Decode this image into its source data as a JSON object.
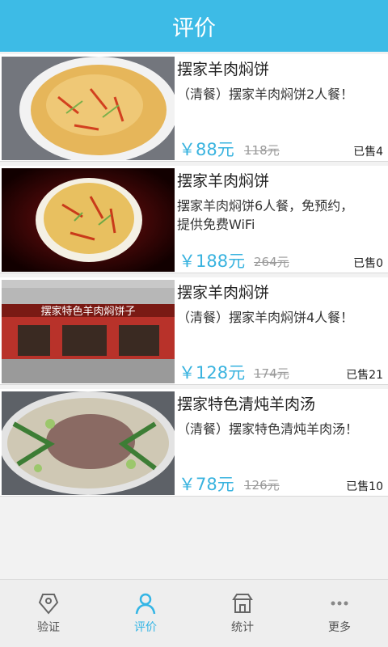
{
  "header": {
    "title": "评价"
  },
  "items": [
    {
      "title": "摆家羊肉焖饼",
      "desc": "（清餐）摆家羊肉焖饼2人餐！",
      "price": "￥88元",
      "orig_price": "118元",
      "sold": "已售4"
    },
    {
      "title": "摆家羊肉焖饼",
      "desc": "摆家羊肉焖饼6人餐，免预约，提供免费WiFi",
      "price": "￥188元",
      "orig_price": "264元",
      "sold": "已售0"
    },
    {
      "title": "摆家羊肉焖饼",
      "desc": "（清餐）摆家羊肉焖饼4人餐！",
      "price": "￥128元",
      "orig_price": "174元",
      "sold": "已售21",
      "sign_text": "摆家特色羊肉焖饼子"
    },
    {
      "title": "摆家特色清炖羊肉汤",
      "desc": "（清餐）摆家特色清炖羊肉汤！",
      "price": "￥78元",
      "orig_price": "126元",
      "sold": "已售10"
    }
  ],
  "tabbar": {
    "tabs": [
      {
        "label": "验证",
        "icon": "coupon-icon"
      },
      {
        "label": "评价",
        "icon": "person-icon",
        "active": true
      },
      {
        "label": "统计",
        "icon": "shop-icon"
      },
      {
        "label": "更多",
        "icon": "more-dots-icon"
      }
    ]
  },
  "colors": {
    "accent": "#3dbbe6",
    "price": "#39b3df"
  }
}
